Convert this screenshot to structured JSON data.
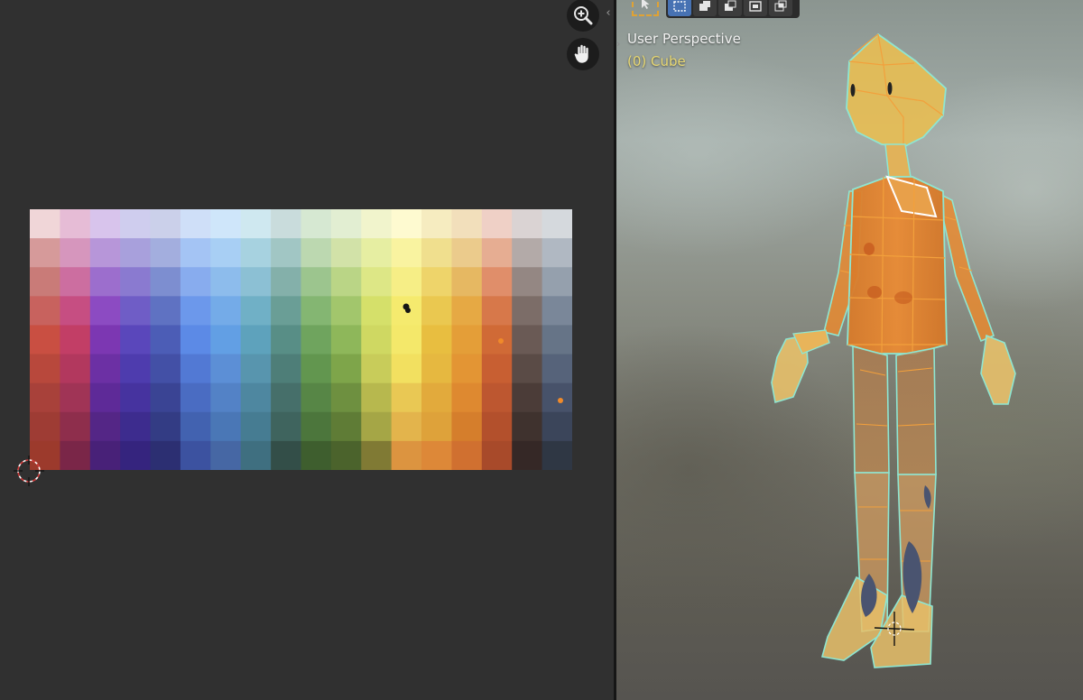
{
  "uv_editor": {
    "nav": {
      "zoom_icon": "magnifier-plus-icon",
      "pan_icon": "hand-icon",
      "collapse_icon": "chevron-left-icon"
    },
    "palette": {
      "rows": [
        [
          "#f0d6d8",
          "#e6bcd6",
          "#d8c4ec",
          "#cfcdee",
          "#cbd0ea",
          "#cfdff8",
          "#cfe6fa",
          "#cfe8f0",
          "#c9dcdc",
          "#d6e8d2",
          "#e2eed2",
          "#f1f4cc",
          "#fefad0",
          "#f6ecc0",
          "#f2dfbb",
          "#efd0c6",
          "#dad3d3",
          "#d5d9dd"
        ],
        [
          "#d69a9a",
          "#d696bd",
          "#b796d9",
          "#a8a0dc",
          "#a3aede",
          "#a4c4f4",
          "#a8cff4",
          "#a7d2e0",
          "#a1c6c4",
          "#bcd8b0",
          "#d2e2a8",
          "#e6eea2",
          "#f9f3a0",
          "#f0df8e",
          "#ebcb8c",
          "#e6ad92",
          "#b3aaa8",
          "#b0b8c2"
        ],
        [
          "#c97b78",
          "#cc6ea0",
          "#9c6ecd",
          "#8a7ad0",
          "#7d8ed0",
          "#88acee",
          "#8dbcec",
          "#8cc0d4",
          "#84b0aa",
          "#9cc58e",
          "#bad586",
          "#dde786",
          "#f6ee86",
          "#eed46a",
          "#e6b862",
          "#e08e6a",
          "#948783",
          "#95a0ad"
        ],
        [
          "#c8625e",
          "#c64e82",
          "#8c4bc2",
          "#6f5dc6",
          "#5f72c2",
          "#6c98eb",
          "#74abe8",
          "#70b0c6",
          "#6a9e96",
          "#84b672",
          "#a2c66c",
          "#d5e06a",
          "#f5ea6e",
          "#eac850",
          "#e6a944",
          "#d7784a",
          "#7c6d68",
          "#7a8799"
        ],
        [
          "#c94f42",
          "#c23e66",
          "#7c37b2",
          "#5a47bb",
          "#4c5db6",
          "#5c8ae6",
          "#629fe4",
          "#5ea2bc",
          "#588e86",
          "#6fa45e",
          "#8eb75a",
          "#cfd862",
          "#f4e86a",
          "#e8be40",
          "#e49e38",
          "#d06a36",
          "#6a5a55",
          "#667487"
        ],
        [
          "#b8483c",
          "#b2385e",
          "#6c30a4",
          "#4e3cae",
          "#4350a6",
          "#5279d4",
          "#5c8fd6",
          "#5895ae",
          "#4e7e78",
          "#62964f",
          "#7ea54a",
          "#c8cc5a",
          "#f2e060",
          "#e6b840",
          "#e39534",
          "#c85f32",
          "#5a4b46",
          "#56637a"
        ],
        [
          "#a8413a",
          "#a03456",
          "#5e2a98",
          "#46339f",
          "#3a4494",
          "#4a6cc2",
          "#5382c6",
          "#4e87a0",
          "#466f6a",
          "#578646",
          "#6e9040",
          "#b7b84e",
          "#e9c854",
          "#e2aa3c",
          "#de8930",
          "#bd5730",
          "#4b3c38",
          "#47526a"
        ],
        [
          "#9e3c34",
          "#8e2e4c",
          "#542686",
          "#3d2c8e",
          "#333c84",
          "#4262b0",
          "#4a77b6",
          "#467c92",
          "#3f645e",
          "#4c763c",
          "#5f7c36",
          "#a5a646",
          "#e3b44c",
          "#dea23a",
          "#d57e2c",
          "#b3502c",
          "#3f322e",
          "#3b455a"
        ],
        [
          "#9c3a2c",
          "#7a2648",
          "#482178",
          "#35247e",
          "#2c2f72",
          "#3c52a0",
          "#4667a4",
          "#3f6f80",
          "#334e48",
          "#3e5e2e",
          "#4b632c",
          "#807a34",
          "#dc9440",
          "#dd8838",
          "#d07030",
          "#a84a2a",
          "#352826",
          "#2f3744"
        ]
      ],
      "cols": 18,
      "row_count": 9
    }
  },
  "viewport": {
    "view_name": "User Perspective",
    "object_name": "(0) Cube",
    "toolbar": {
      "tool_icon": "select-cursor-icon",
      "modes": [
        {
          "icon": "select-box-new-icon",
          "active": true
        },
        {
          "icon": "select-box-extend-icon",
          "active": false
        },
        {
          "icon": "select-box-subtract-icon",
          "active": false
        },
        {
          "icon": "select-box-invert-icon",
          "active": false
        },
        {
          "icon": "select-box-intersect-icon",
          "active": false
        }
      ]
    },
    "colors": {
      "mesh_fill": "#e98a2e",
      "edge_select": "#f2a03c",
      "edge_outline": "#8ee6d2",
      "head_fill": "#e6bd55"
    }
  }
}
